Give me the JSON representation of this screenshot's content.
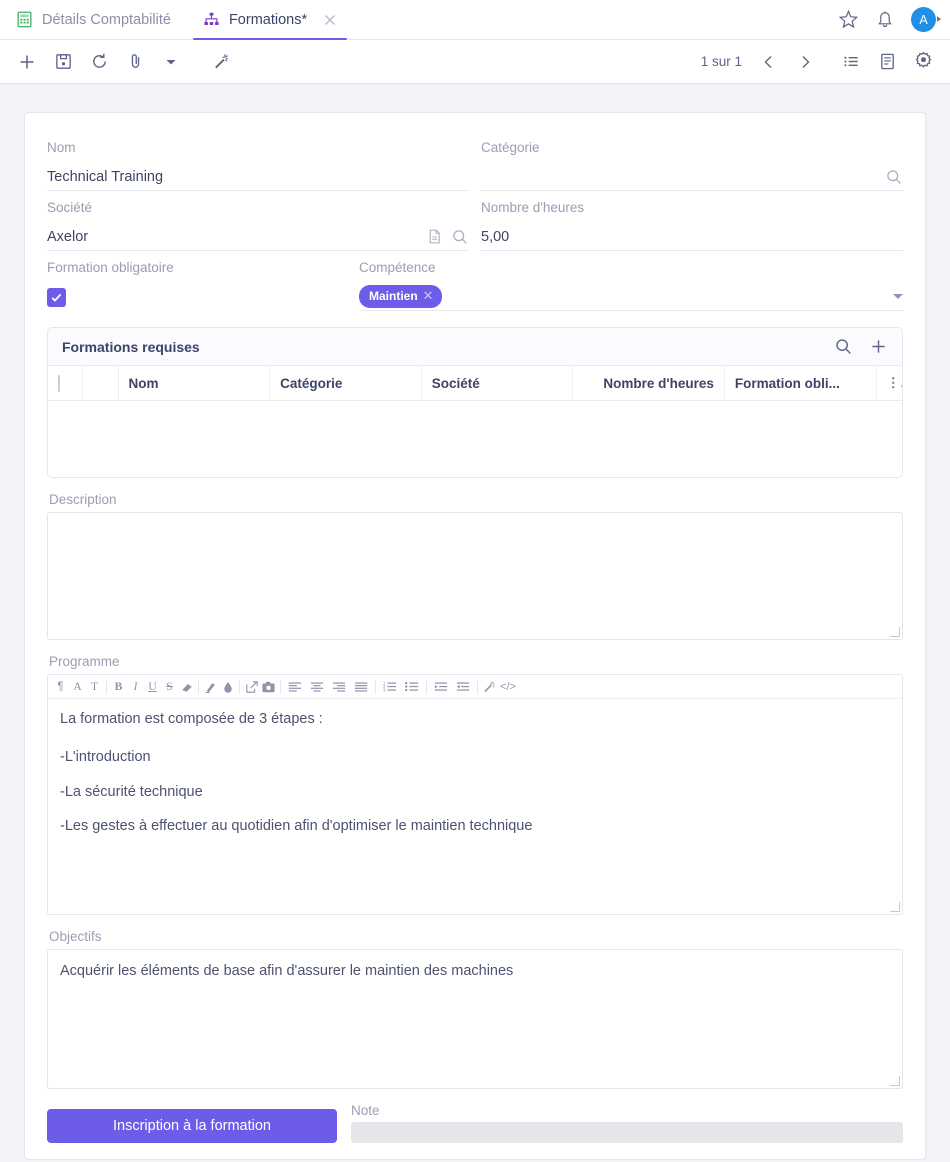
{
  "window": {
    "tabs": [
      {
        "label": "Détails Comptabilité",
        "icon": "calculator-icon",
        "active": false,
        "closable": false
      },
      {
        "label": "Formations*",
        "icon": "sitemap-icon",
        "active": true,
        "closable": true
      }
    ],
    "right_icons": [
      "star-icon",
      "bell-icon"
    ],
    "avatar_initial": "A"
  },
  "toolbar": {
    "left_icons": [
      "plus-icon",
      "save-icon",
      "refresh-icon",
      "attachment-icon",
      "chevron-down-icon",
      "magic-wand-icon"
    ],
    "pager_text": "1 sur 1",
    "right_icons": [
      "chevron-left-icon",
      "chevron-right-icon",
      "list-view-icon",
      "form-view-icon",
      "gear-icon"
    ]
  },
  "form": {
    "nom": {
      "label": "Nom",
      "value": "Technical Training"
    },
    "categorie": {
      "label": "Catégorie",
      "value": "",
      "adornments": [
        "search-icon"
      ]
    },
    "societe": {
      "label": "Société",
      "value": "Axelor",
      "adornments": [
        "document-icon",
        "search-icon"
      ]
    },
    "nombre_heures": {
      "label": "Nombre d'heures",
      "value": "5,00"
    },
    "formation_obligatoire": {
      "label": "Formation obligatoire",
      "checked": true,
      "check_glyph": "check-icon"
    },
    "competence": {
      "label": "Compétence",
      "tags": [
        {
          "label": "Maintien",
          "remove_glyph": "close-icon"
        }
      ],
      "dropdown_glyph": "chevron-down-icon"
    },
    "description": {
      "label": "Description",
      "value": ""
    },
    "programme": {
      "label": "Programme",
      "toolbar_icons": [
        "paragraph-icon",
        "font-family-icon",
        "font-size-icon",
        "bold-icon",
        "italic-icon",
        "underline-icon",
        "strikethrough-icon",
        "eraser-icon",
        "text-color-icon",
        "highlight-color-icon",
        "link-icon",
        "image-icon",
        "align-left-icon",
        "align-center-icon",
        "align-right-icon",
        "align-justify-icon",
        "ordered-list-icon",
        "unordered-list-icon",
        "indent-icon",
        "outdent-icon",
        "magic-wand-icon",
        "code-view-icon"
      ],
      "paragraphs": [
        "La formation est composée de 3 étapes :",
        "-L'introduction",
        "-La sécurité technique",
        "-Les gestes à effectuer au quotidien afin d'optimiser le maintien technique"
      ]
    },
    "objectifs": {
      "label": "Objectifs",
      "value": "Acquérir les éléments de base afin d'assurer le maintien des machines"
    },
    "note": {
      "label": "Note",
      "value": ""
    },
    "submit_button": {
      "label": "Inscription à la formation"
    }
  },
  "formations_requises": {
    "title": "Formations requises",
    "actions": [
      "search-icon",
      "plus-icon"
    ],
    "columns": [
      "",
      "",
      "Nom",
      "Catégorie",
      "Société",
      "Nombre d'heures",
      "Formation obli...",
      ""
    ],
    "rows": []
  },
  "colors": {
    "accent": "#6c5ce7",
    "avatar": "#1e90e6",
    "text": "#3d4465",
    "label": "#9a9eb2",
    "tag": "#6c5ce7"
  }
}
